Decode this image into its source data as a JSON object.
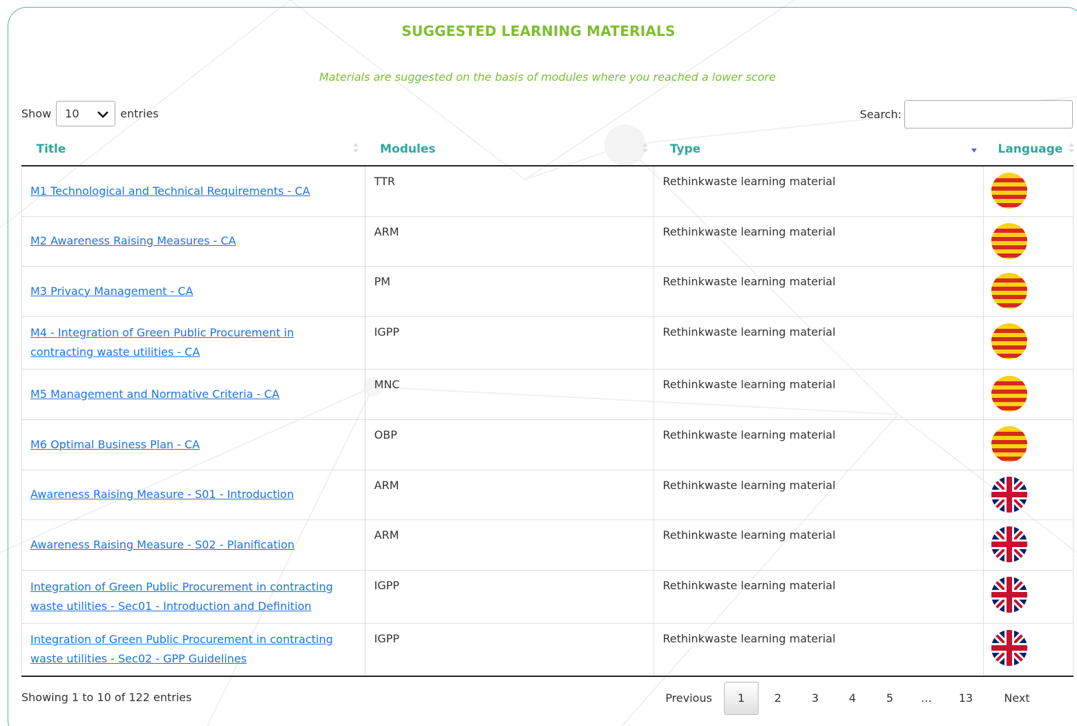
{
  "header": {
    "title": "SUGGESTED LEARNING MATERIALS",
    "subtitle": "Materials are suggested on the basis of modules where you reached a lower score"
  },
  "controls": {
    "show_label": "Show",
    "entries_label": "entries",
    "page_length": "10",
    "search_label": "Search:",
    "search_value": ""
  },
  "table": {
    "columns": [
      "Title",
      "Modules",
      "Type",
      "Language"
    ],
    "sorted_column": "Type",
    "rows": [
      {
        "title": "M1 Technological and Technical Requirements - CA",
        "module": "TTR",
        "type": "Rethinkwaste learning material",
        "language": "catalan-flag-icon"
      },
      {
        "title": "M2 Awareness Raising Measures - CA",
        "module": "ARM",
        "type": "Rethinkwaste learning material",
        "language": "catalan-flag-icon"
      },
      {
        "title": "M3 Privacy Management - CA",
        "module": "PM",
        "type": "Rethinkwaste learning material",
        "language": "catalan-flag-icon"
      },
      {
        "title": "M4 - Integration of Green Public Procurement in contracting waste utilities - CA",
        "module": "IGPP",
        "type": "Rethinkwaste learning material",
        "language": "catalan-flag-icon"
      },
      {
        "title": "M5 Management and Normative Criteria - CA",
        "module": "MNC",
        "type": "Rethinkwaste learning material",
        "language": "catalan-flag-icon"
      },
      {
        "title": "M6 Optimal Business Plan - CA",
        "module": "OBP",
        "type": "Rethinkwaste learning material",
        "language": "catalan-flag-icon"
      },
      {
        "title": "Awareness Raising Measure - S01 - Introduction",
        "module": "ARM",
        "type": "Rethinkwaste learning material",
        "language": "uk-flag-icon"
      },
      {
        "title": "Awareness Raising Measure - S02 - Planification",
        "module": "ARM",
        "type": "Rethinkwaste learning material",
        "language": "uk-flag-icon"
      },
      {
        "title": "Integration of Green Public Procurement in contracting waste utilities - Sec01 - Introduction and Definition",
        "module": "IGPP",
        "type": "Rethinkwaste learning material",
        "language": "uk-flag-icon"
      },
      {
        "title": "Integration of Green Public Procurement in contracting waste utilities - Sec02 - GPP Guidelines",
        "module": "IGPP",
        "type": "Rethinkwaste learning material",
        "language": "uk-flag-icon"
      }
    ]
  },
  "footer": {
    "info": "Showing 1 to 10 of 122 entries",
    "previous": "Previous",
    "pages": [
      "1",
      "2",
      "3",
      "4",
      "5",
      "…",
      "13"
    ],
    "current_page": "1",
    "next": "Next"
  },
  "colors": {
    "title_green": "#7cbf2f",
    "header_teal": "#2ba99c",
    "link_blue": "#1b73e8",
    "border_teal": "#47b8a6"
  }
}
